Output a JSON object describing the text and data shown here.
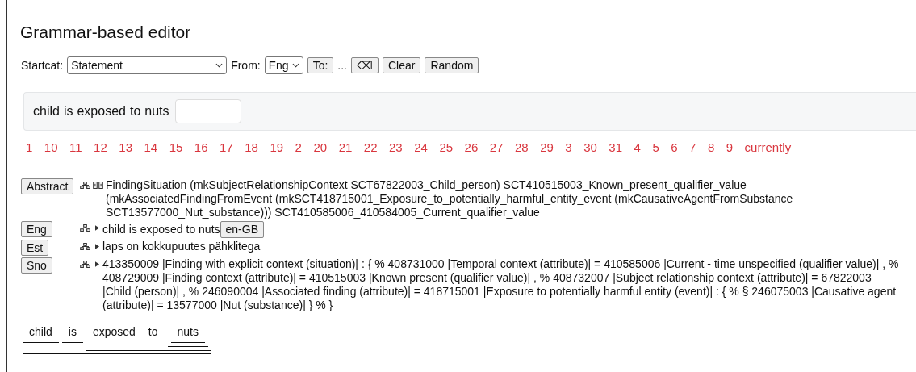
{
  "title": "Grammar-based editor",
  "toolbar": {
    "startcat_label": "Startcat:",
    "startcat": "Statement",
    "from_label": "From:",
    "from": "Eng",
    "to_button": "To:",
    "ellipsis": "...",
    "backspace": "⌫",
    "clear": "Clear",
    "random": "Random"
  },
  "sentence": {
    "words": [
      "child",
      "is",
      "exposed",
      "to",
      "nuts"
    ]
  },
  "completions": [
    "1",
    "10",
    "11",
    "12",
    "13",
    "14",
    "15",
    "16",
    "17",
    "18",
    "19",
    "2",
    "20",
    "21",
    "22",
    "23",
    "24",
    "25",
    "26",
    "27",
    "28",
    "29",
    "3",
    "30",
    "31",
    "4",
    "5",
    "6",
    "7",
    "8",
    "9",
    "currently"
  ],
  "linearizations": [
    {
      "button": "Abstract",
      "kind": "abstract",
      "text": "FindingSituation (mkSubjectRelationshipContext SCT67822003_Child_person) SCT410515003_Known_present_qualifier_value (mkAssociatedFindingFromEvent (mkSCT418715001_Exposure_to_potentially_harmful_entity_event (mkCausativeAgentFromSubstance SCT13577000_Nut_substance))) SCT410585006_410584005_Current_qualifier_value"
    },
    {
      "button": "Eng",
      "kind": "language",
      "text": "child is exposed to nuts",
      "extra_button": "en-GB"
    },
    {
      "button": "Est",
      "kind": "language",
      "text": "laps on kokkupuutes pähklitega"
    },
    {
      "button": "Sno",
      "kind": "language",
      "text": "413350009 |Finding with explicit context (situation)| : { % 408731000 |Temporal context (attribute)| = 410585006 |Current - time unspecified (qualifier value)| , % 408729009 |Finding context (attribute)| = 410515003 |Known present (qualifier value)| , % 408732007 |Subject relationship context (attribute)| = 67822003 |Child (person)| , % 246090004 |Associated finding (attribute)| = 418715001 |Exposure to potentially harmful entity (event)| : { % § 246075003 |Causative agent (attribute)| = 13577000 |Nut (substance)| } % }"
    }
  ],
  "parse_tree": {
    "children": [
      {
        "children": [
          {
            "word": "child"
          }
        ]
      },
      {
        "children": [
          {
            "word": "is"
          }
        ]
      },
      {
        "children": [
          {
            "word": "exposed"
          },
          {
            "word": "to"
          },
          {
            "children": [
              {
                "children": [
                  {
                    "word": "nuts"
                  }
                ]
              }
            ]
          }
        ]
      }
    ]
  }
}
